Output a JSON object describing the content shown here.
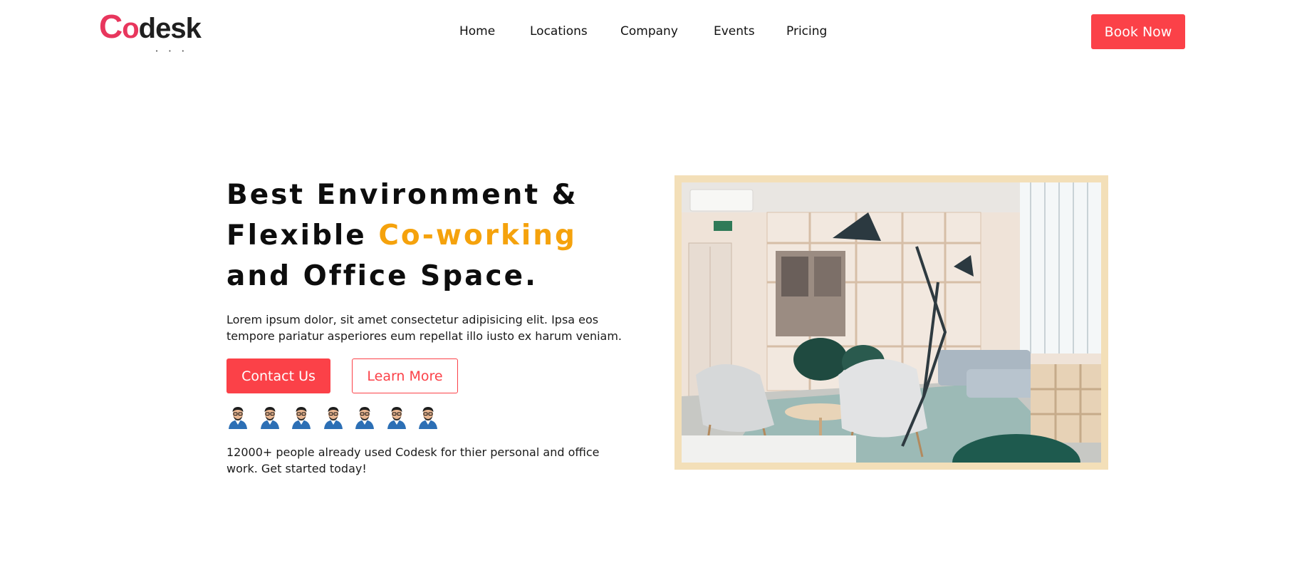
{
  "header": {
    "logo": {
      "first": "C",
      "second": "o",
      "rest": "desk",
      "dots": "• • •"
    },
    "nav": [
      "Home",
      "Locations",
      "Company",
      "Events",
      "Pricing"
    ],
    "book_label": "Book Now"
  },
  "hero": {
    "headline_line1": "Best Environment &",
    "headline_line2_plain": "Flexible ",
    "headline_line2_accent": "Co-working",
    "headline_line3": "and Office Space.",
    "body": "Lorem ipsum dolor, sit amet consectetur adipisicing elit. Ipsa eos tempore pariatur asperiores eum repellat illo iusto ex harum veniam.",
    "contact_label": "Contact Us",
    "learn_label": "Learn More",
    "avatar_count": 7,
    "social_proof": "12000+ people already used Codesk for thier personal and office work. Get started today!"
  },
  "colors": {
    "primary": "#fb4148",
    "accent": "#f5a20c",
    "logo": "#e8365d",
    "frame": "#f3dfb8"
  },
  "icons": {
    "avatar": "user-avatar-icon"
  }
}
